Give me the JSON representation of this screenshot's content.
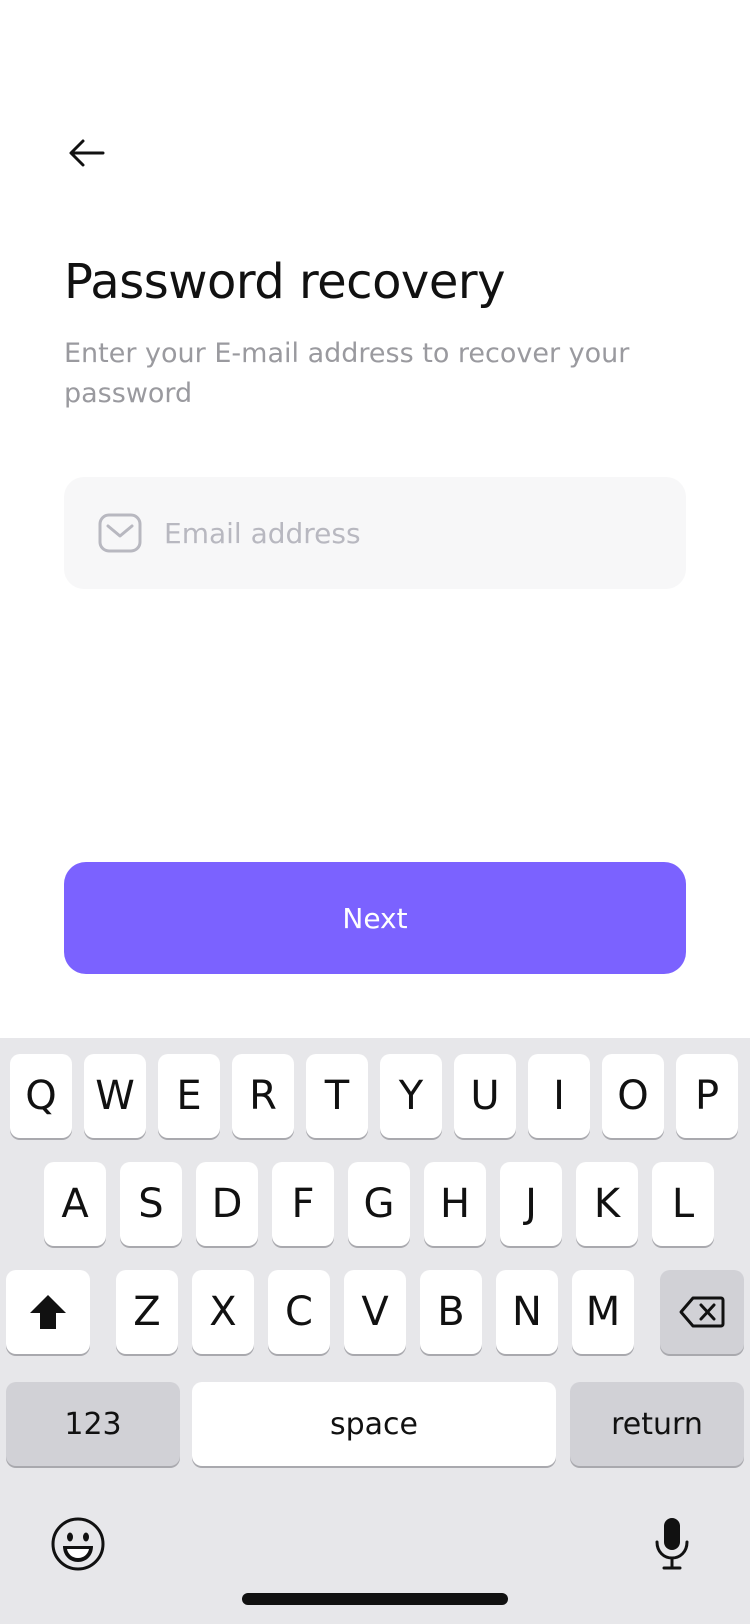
{
  "header": {
    "back_icon": "arrow-left-icon"
  },
  "title": "Password recovery",
  "subtitle": "Enter your E-mail address to recover your password",
  "email_field": {
    "placeholder": "Email address",
    "value": "",
    "icon": "envelope-icon"
  },
  "next_button": {
    "label": "Next",
    "color": "#7b62ff"
  },
  "keyboard": {
    "row1": [
      "Q",
      "W",
      "E",
      "R",
      "T",
      "Y",
      "U",
      "I",
      "O",
      "P"
    ],
    "row2": [
      "A",
      "S",
      "D",
      "F",
      "G",
      "H",
      "J",
      "K",
      "L"
    ],
    "row3": [
      "Z",
      "X",
      "C",
      "V",
      "B",
      "N",
      "M"
    ],
    "shift_icon": "shift-icon",
    "backspace_icon": "backspace-icon",
    "numbers_label": "123",
    "space_label": "space",
    "return_label": "return",
    "emoji_icon": "emoji-icon",
    "mic_icon": "microphone-icon"
  }
}
